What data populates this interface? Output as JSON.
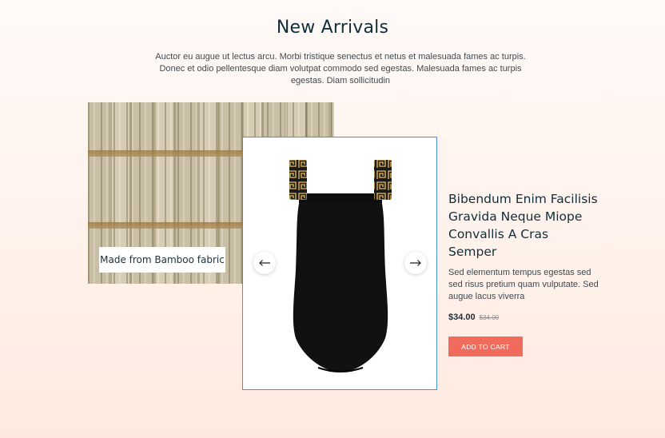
{
  "section": {
    "title": "New Arrivals",
    "description": "Auctor eu augue ut lectus arcu. Morbi tristique senectus et netus et malesuada fames ac turpis. Donec et odio pellentesque diam volutpat commodo sed egestas. Malesuada fames ac turpis egestas. Diam sollicitudin"
  },
  "feature_image": {
    "label": "Made from Bamboo fabric"
  },
  "carousel": {
    "prev_icon": "arrow-left-icon",
    "next_icon": "arrow-right-icon"
  },
  "product": {
    "title": "Bibendum Enim Facilisis Gravida Neque Miope Convallis A Cras Semper",
    "description": "Sed elementum tempus egestas sed sed risus pretium quam vulputate. Sed augue lacus viverra",
    "price": "$34.00",
    "old_price": "$34.00",
    "add_to_cart_label": "ADD TO CART"
  },
  "colors": {
    "accent": "#f06b5c",
    "heading": "#0f2f3a",
    "card_border": "#4a90e2"
  }
}
